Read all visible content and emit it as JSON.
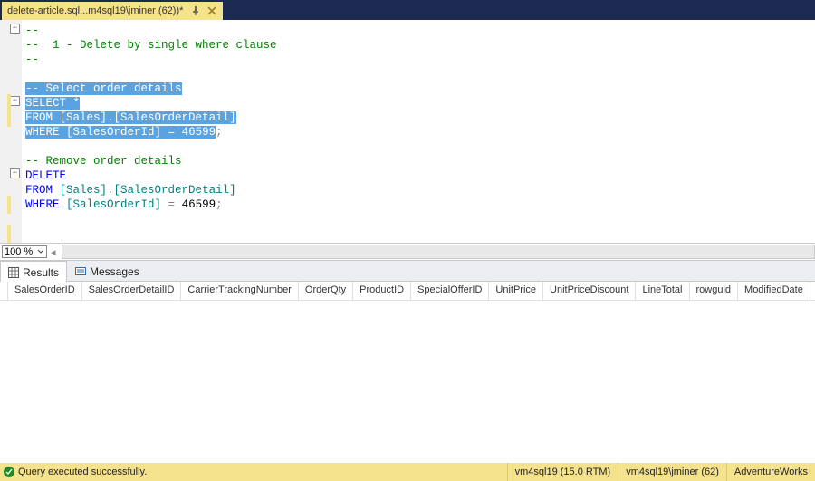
{
  "tab": {
    "title": "delete-article.sql...m4sql19\\jminer (62))*"
  },
  "code": {
    "c1": "--",
    "c2": "--  1 - Delete by single where clause",
    "c3": "--",
    "c4": "-- Select order details",
    "kw_select": "SELECT",
    "star": " *",
    "kw_from1": "FROM ",
    "obj1a": "[Sales]",
    "dot1": ".",
    "obj1b": "[SalesOrderDetail]",
    "kw_where1": "WHERE ",
    "col1": "[SalesOrderId]",
    "eq": " = ",
    "val1": "46599",
    "semi": ";",
    "c5": "-- Remove order details",
    "kw_delete": "DELETE",
    "kw_from2": "FROM ",
    "obj2a": "[Sales]",
    "dot2": ".",
    "obj2b": "[SalesOrderDetail]",
    "kw_where2": "WHERE ",
    "col2": "[SalesOrderId]",
    "val2": "46599"
  },
  "zoom": {
    "value": "100 %"
  },
  "result_tabs": {
    "results": "Results",
    "messages": "Messages"
  },
  "columns": [
    "SalesOrderID",
    "SalesOrderDetailID",
    "CarrierTrackingNumber",
    "OrderQty",
    "ProductID",
    "SpecialOfferID",
    "UnitPrice",
    "UnitPriceDiscount",
    "LineTotal",
    "rowguid",
    "ModifiedDate"
  ],
  "status": {
    "msg": "Query executed successfully.",
    "server": "vm4sql19 (15.0 RTM)",
    "login": "vm4sql19\\jminer (62)",
    "db": "AdventureWorks"
  }
}
